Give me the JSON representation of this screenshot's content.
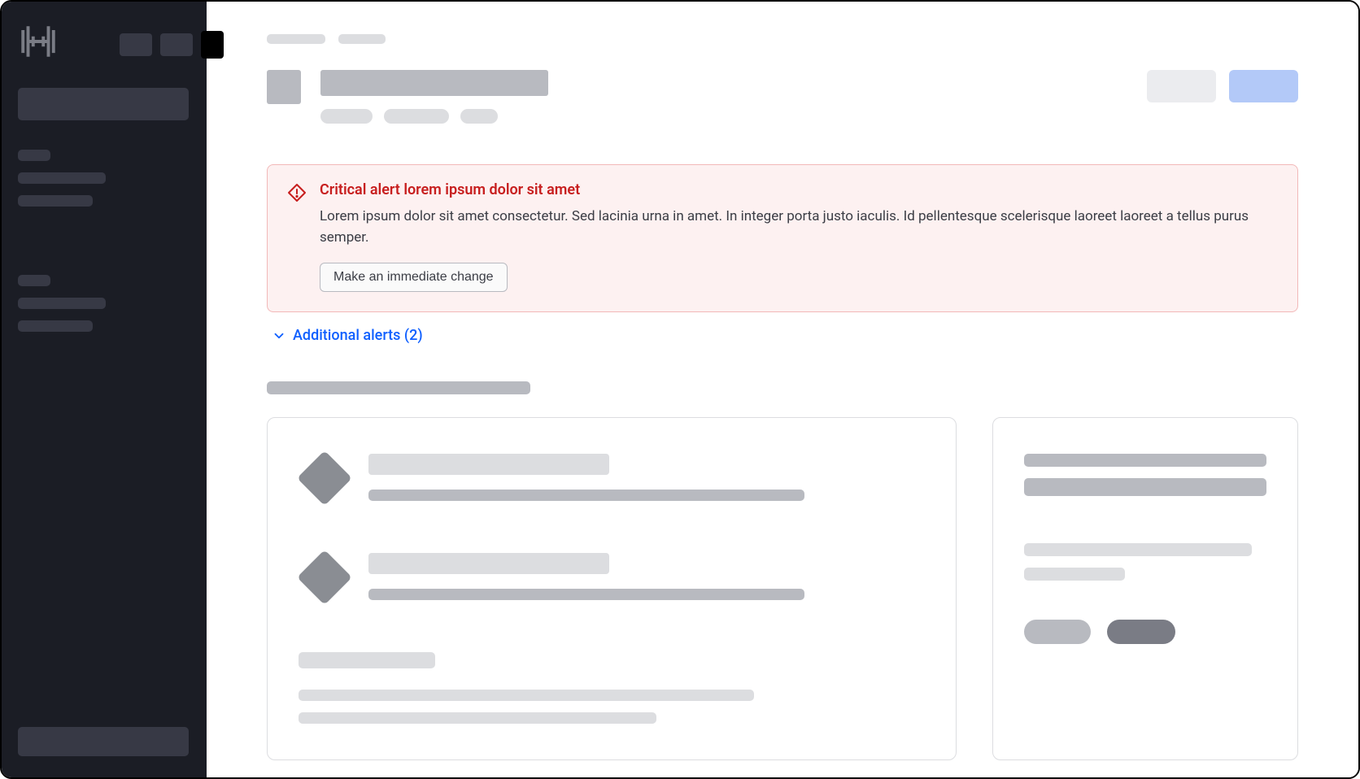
{
  "alert": {
    "title": "Critical alert lorem ipsum dolor sit amet",
    "description": "Lorem ipsum dolor sit amet consectetur. Sed lacinia urna in amet. In integer porta justo iaculis. Id pellentesque scelerisque laoreet laoreet a tellus purus semper.",
    "action_label": "Make an immediate change"
  },
  "additional_alerts": {
    "label": "Additional alerts (2)",
    "count": 2
  },
  "colors": {
    "critical": "#c71e1e",
    "critical_bg": "#fdf1f1",
    "critical_border": "#f2b8b8",
    "link": "#1060ff",
    "sidebar_bg": "#1b1d25",
    "primary_btn": "#b3c9f8"
  }
}
